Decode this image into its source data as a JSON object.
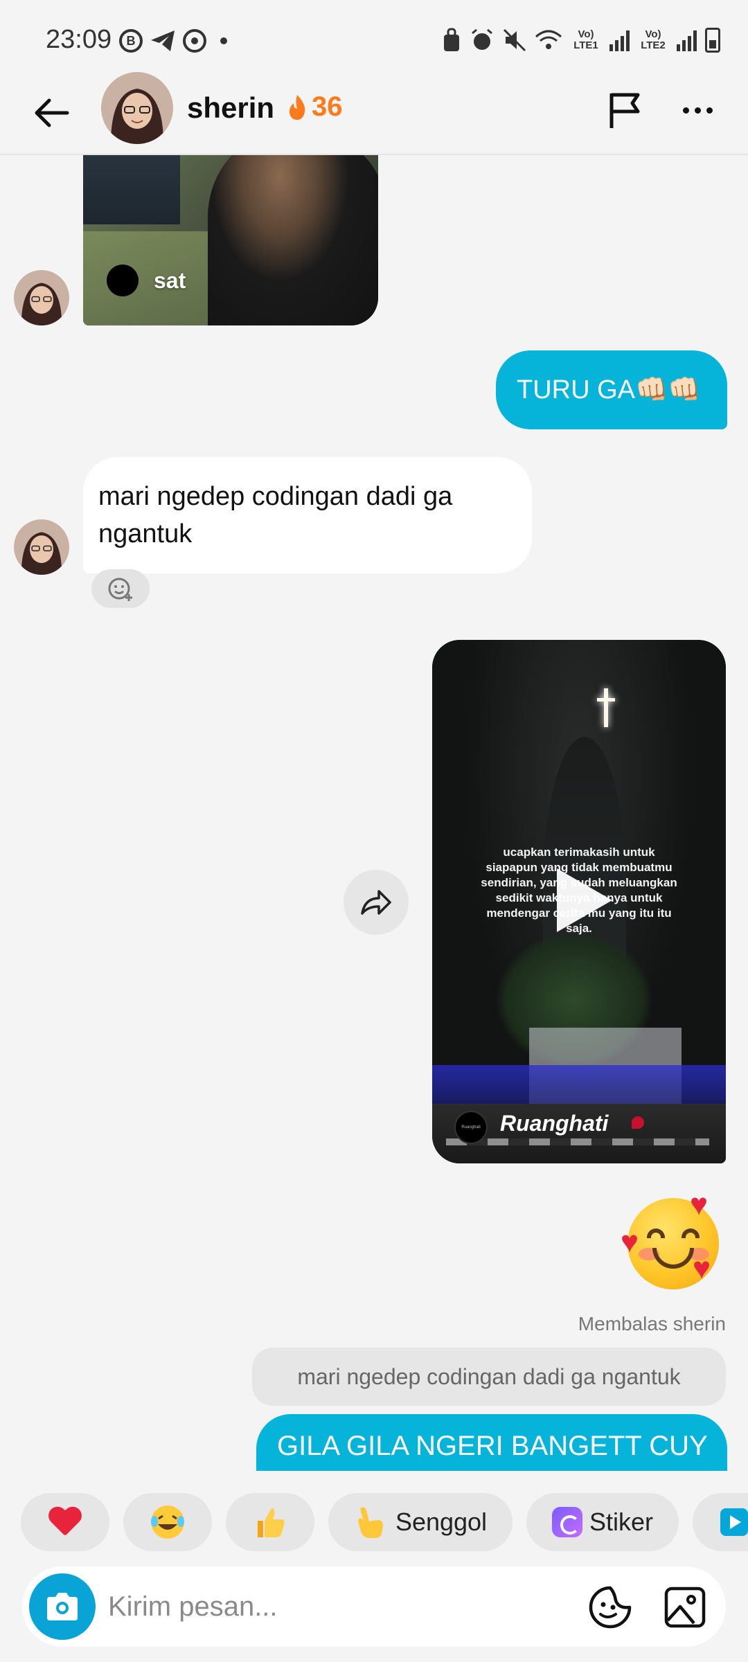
{
  "status_bar": {
    "time": "23:09",
    "left_icons": [
      "b-icon",
      "telegram-icon",
      "target-icon",
      "dot-icon"
    ],
    "right_icons": [
      "vpn-icon",
      "alarm-icon",
      "mute-icon",
      "wifi-icon",
      "signal-icon",
      "signal-icon",
      "battery-icon"
    ],
    "sim1_label": "Vo) LTE1",
    "sim2_label": "Vo) LTE2"
  },
  "header": {
    "contact_name": "sherin",
    "streak_count": "36",
    "streak_color": "#ff7a1a"
  },
  "messages": {
    "photo_caption": "sat",
    "outgoing_1": "TURU GA👊🏻👊🏻",
    "incoming_1": "mari ngedep codingan dadi ga ngantuk",
    "video_overlay_text": "ucapkan terimakasih untuk siapapun yang tidak membuatmu sendirian, yang sudah meluangkan sedikit waktunya hanya untuk mendengar cerita mu yang itu itu saja.",
    "video_channel": "Ruanghati",
    "video_logo_text": "Ruanghati",
    "emoji_sticker": "smiling-face-with-hearts",
    "reply_label": "Membalas sherin",
    "reply_quote": "mari ngedep codingan dadi ga ngantuk",
    "reply_text": "GILA GILA NGERI BANGETT CUY"
  },
  "quick_replies": {
    "senggol": "Senggol",
    "stiker": "Stiker"
  },
  "composer": {
    "placeholder": "Kirim pesan..."
  },
  "colors": {
    "outgoing_bubble": "#05b4d8",
    "camera_button": "#0aa3d6",
    "background": "#f4f4f4"
  }
}
